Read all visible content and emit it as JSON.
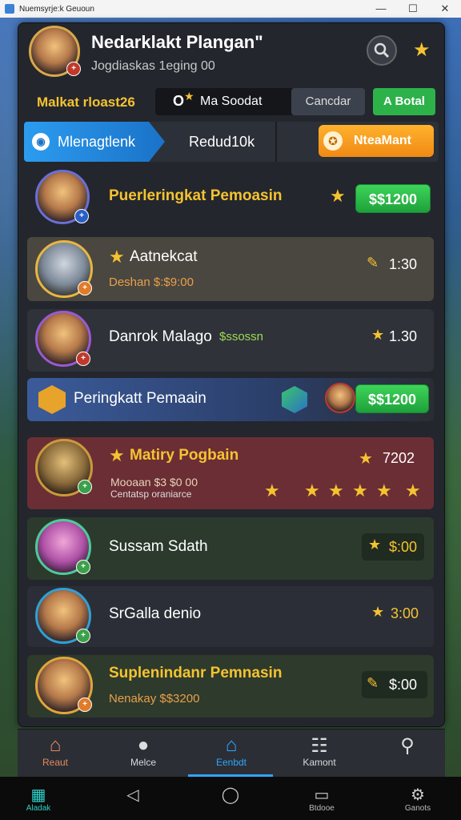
{
  "window": {
    "title": "Nuemsyrje:k Geuoun",
    "controls": [
      "—",
      "☐",
      "✕"
    ]
  },
  "header": {
    "name": "Nedarklakt Plangan\"",
    "subtitle": "Jogdiaskas 1eging 00"
  },
  "action_row": {
    "label": "Malkat rloast26",
    "group_text": "Ma Soodat",
    "group_prefix": "O",
    "cancel": "Cancdar",
    "accept": "A Botal"
  },
  "tabs": {
    "active": "Mlenagtlenk",
    "second": "Redud10k",
    "special": "NteaMant"
  },
  "cards": [
    {
      "title": "Puerleringkat Pemoasin",
      "value": "$$1200"
    },
    {
      "title": "Aatnekcat",
      "sub": "Deshan $:$9:00",
      "value": "1:30"
    },
    {
      "title": "Danrok Malago",
      "sub": "$ssossn",
      "value": "1.30"
    },
    {
      "title": "Peringkatt Pemaain",
      "value": "$$1200"
    },
    {
      "title": "Matiry Pogbain",
      "sub": "Mooaan $3 $0 00",
      "sub2": "Centatsp oraniarce",
      "value": "7202"
    },
    {
      "title": "Sussam Sdath",
      "value": "$:00"
    },
    {
      "title": "SrGalla denio",
      "value": "3:00"
    },
    {
      "title": "Suplenindanr Pemnasin",
      "sub": "Nenakay $$3200",
      "value": "$:00"
    }
  ],
  "bottom_nav": [
    {
      "label": "Reaut",
      "icon": "home-icon"
    },
    {
      "label": "Melce",
      "icon": "chat-icon"
    },
    {
      "label": "Eenbdt",
      "icon": "home-blue-icon"
    },
    {
      "label": "Kamont",
      "icon": "shop-icon"
    },
    {
      "label": "",
      "icon": "wrench-icon"
    }
  ],
  "system_bar": [
    {
      "label": "Aladak",
      "icon": "apps-icon"
    },
    {
      "label": "",
      "icon": "back-icon"
    },
    {
      "label": "",
      "icon": "home-circle-icon"
    },
    {
      "label": "Btdooe",
      "icon": "window-icon"
    },
    {
      "label": "Ganots",
      "icon": "settings-icon"
    }
  ]
}
